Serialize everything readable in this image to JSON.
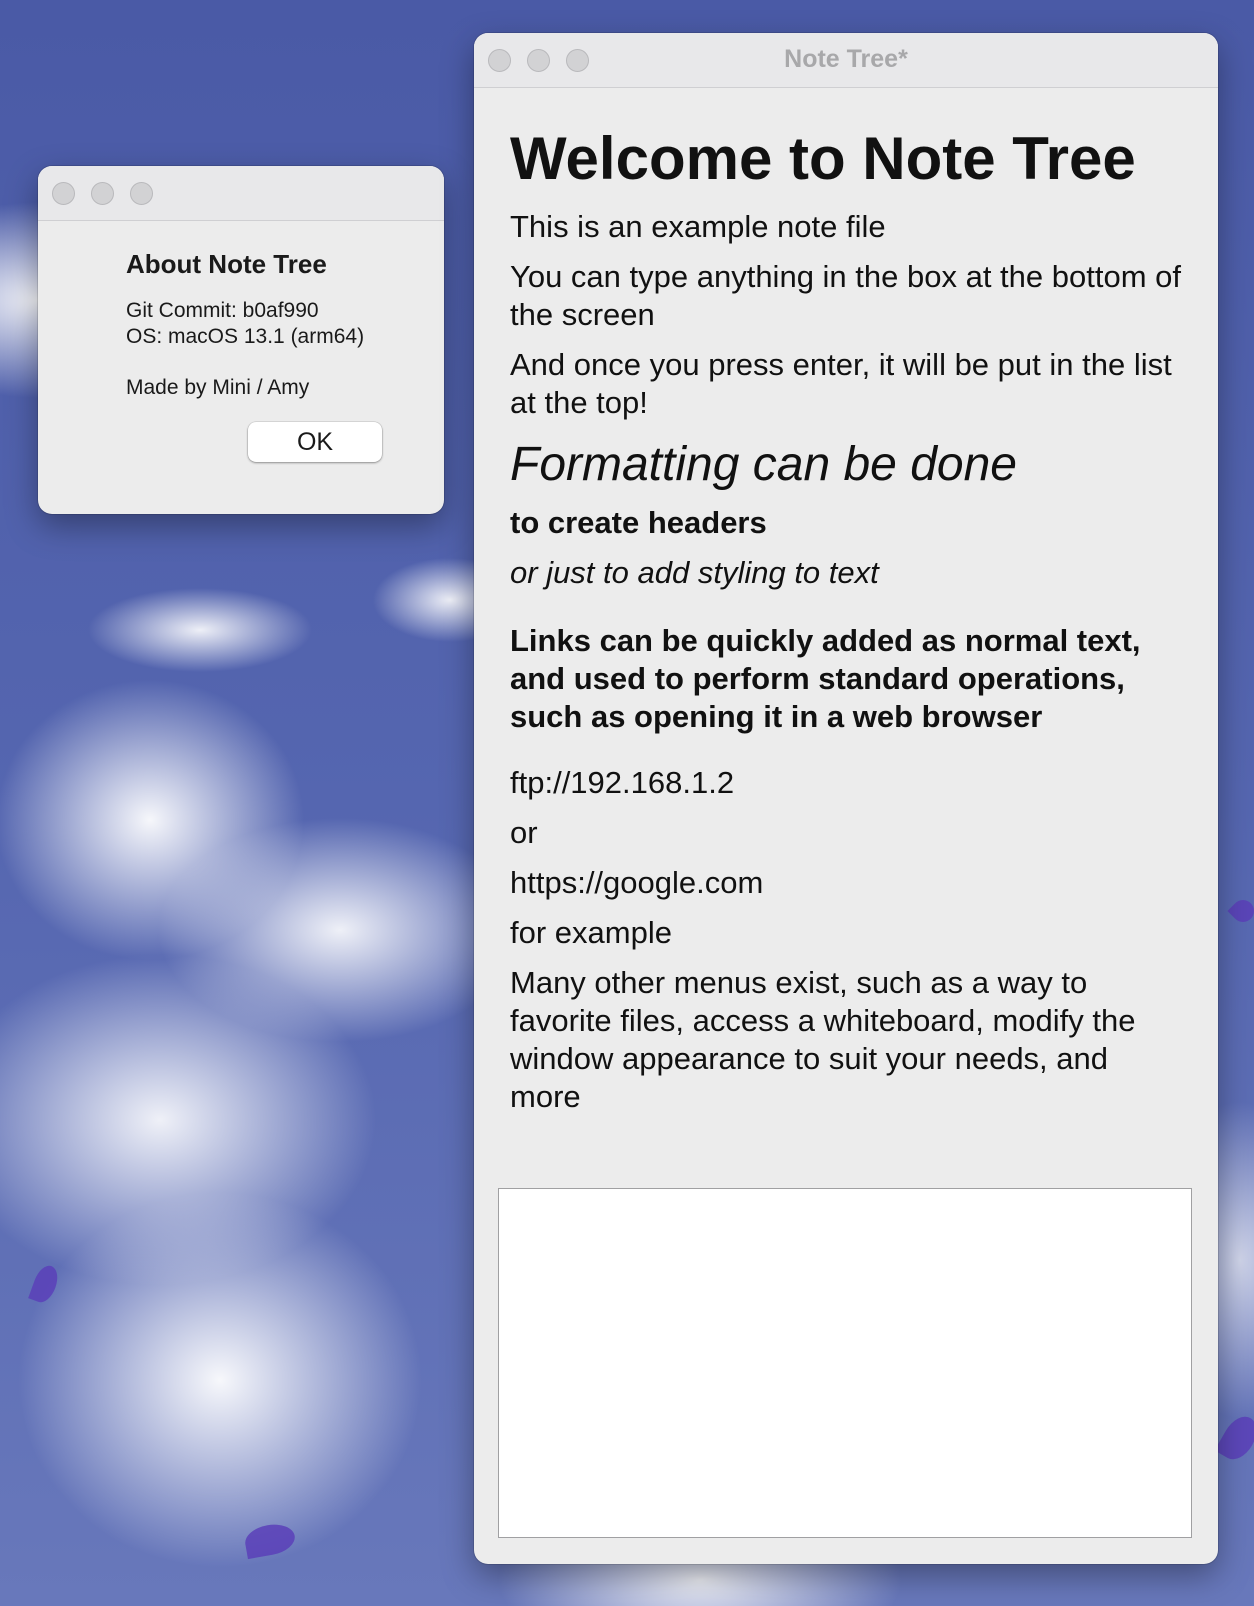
{
  "about_dialog": {
    "title": "About Note Tree",
    "git_commit": "Git Commit: b0af990",
    "os": "OS: macOS 13.1 (arm64)",
    "made_by": "Made by Mini / Amy",
    "ok_label": "OK"
  },
  "main_window": {
    "title": "Note Tree*",
    "notes": {
      "heading": "Welcome to Note Tree",
      "line1": "This is an example note file",
      "line2": "You can type anything in the box at the bottom of the screen",
      "line3": "And once you press enter, it will be put in the list at the top!",
      "subheading": "Formatting can be done",
      "bold_line": "to create headers",
      "italic_line": "or just to add styling to text",
      "links_note": "Links can be quickly added as normal text, and used to perform standard operations, such as opening it in a web browser",
      "link1": "ftp://192.168.1.2",
      "or": "or",
      "link2": "https://google.com",
      "for_example": "for example",
      "closing": "Many other menus exist, such as a way to favorite files, access a whiteboard, modify the window appearance to suit your needs, and more"
    },
    "input": {
      "value": ""
    }
  }
}
